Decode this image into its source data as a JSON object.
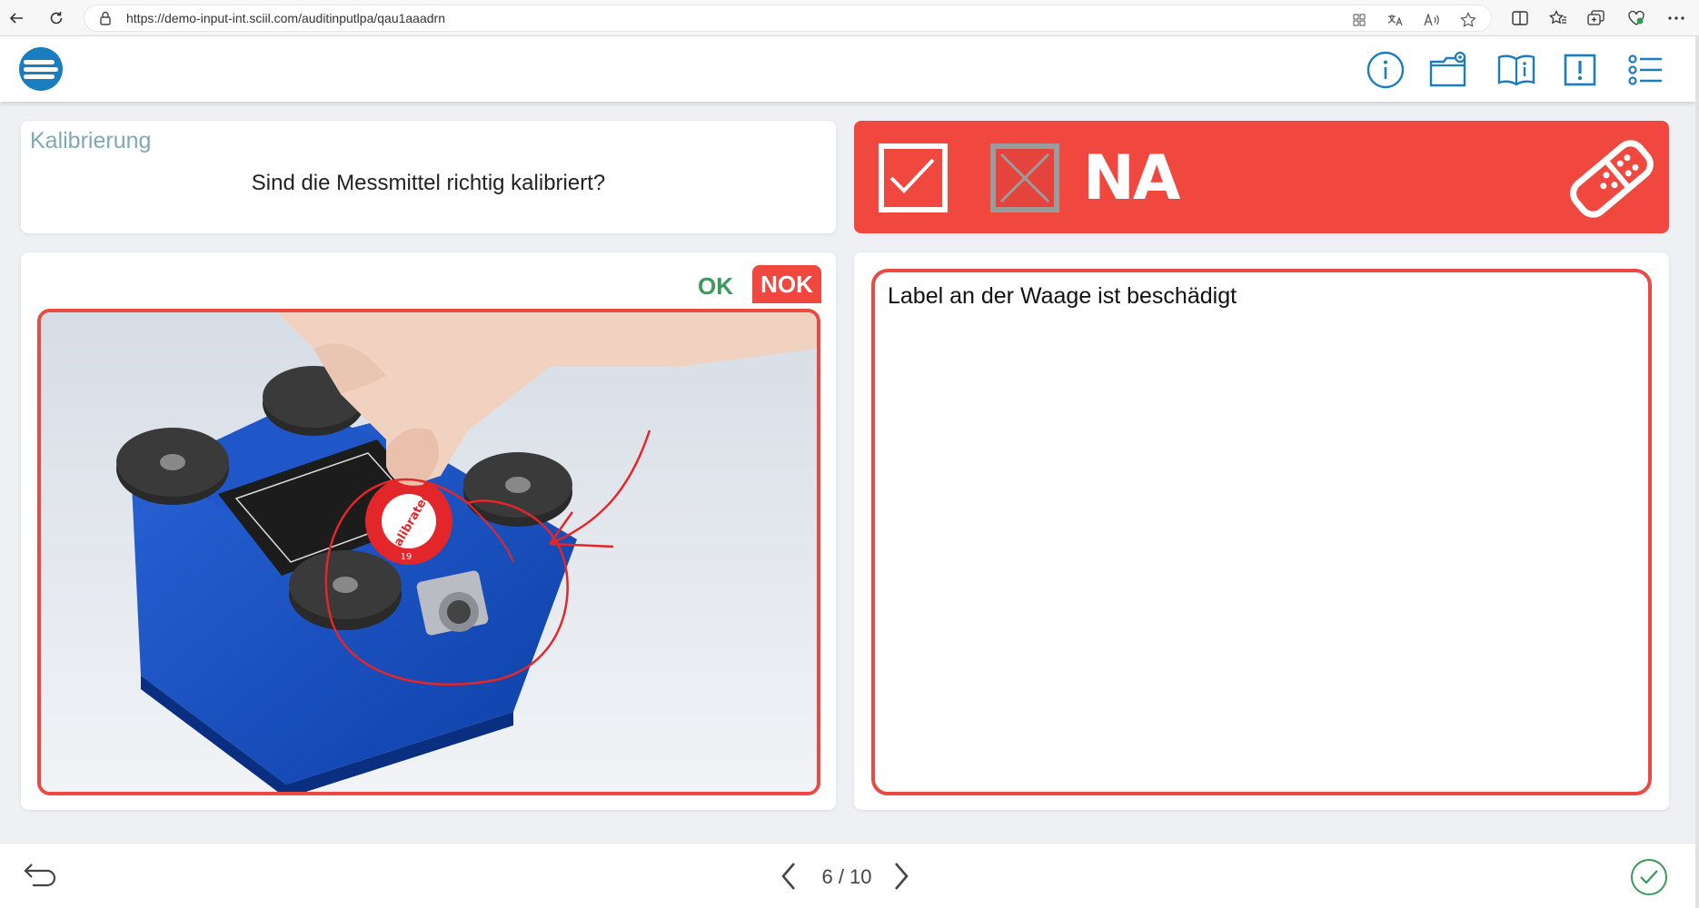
{
  "browser": {
    "url": "https://demo-input-int.sciil.com/auditinputlpa/qau1aaadrn"
  },
  "header": {
    "icons": [
      "info-icon",
      "folder-icon",
      "manual-icon",
      "alert-icon",
      "list-icon"
    ]
  },
  "question": {
    "category": "Kalibrierung",
    "text": "Sind die Messmittel richtig kalibriert?"
  },
  "status": {
    "na_label": "NA",
    "colors": {
      "accent": "#f0473f",
      "ok": "#3a9a5c",
      "category": "#7fa9b1"
    }
  },
  "photo": {
    "ok_label": "OK",
    "nok_label": "NOK",
    "sticker_text": "calibrated",
    "sticker_year": "19"
  },
  "comment": {
    "text": "Label an der Waage ist beschädigt"
  },
  "footer": {
    "pager": "6 / 10"
  }
}
